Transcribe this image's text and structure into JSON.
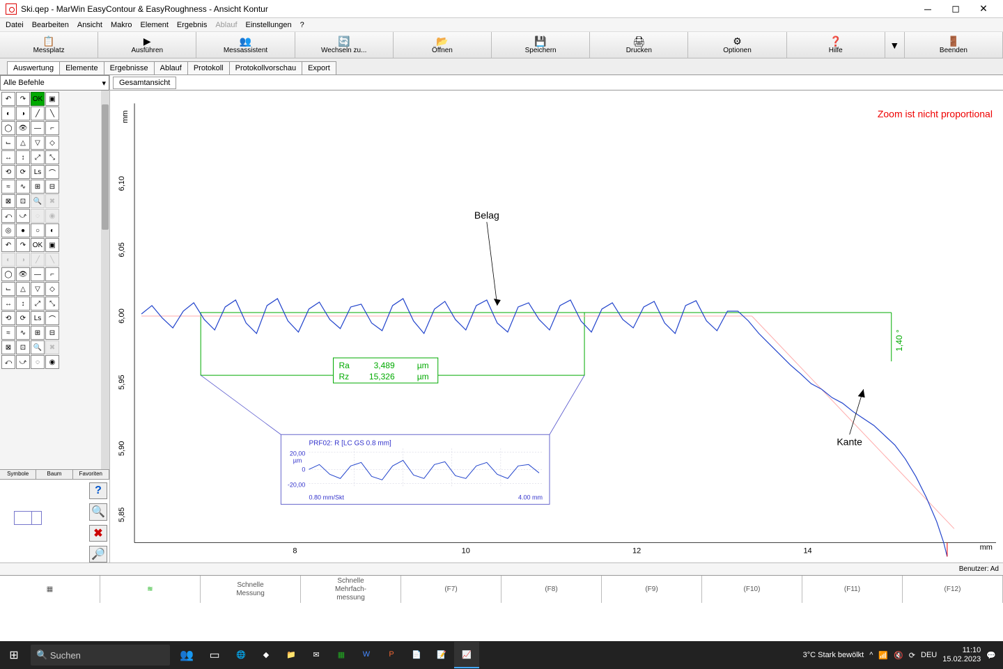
{
  "title": "Ski.qep - MarWin EasyContour & EasyRoughness - Ansicht Kontur",
  "menu": [
    "Datei",
    "Bearbeiten",
    "Ansicht",
    "Makro",
    "Element",
    "Ergebnis",
    "Ablauf",
    "Einstellungen",
    "?"
  ],
  "menu_disabled_index": 6,
  "toolbar": [
    {
      "icon": "📋",
      "label": "Messplatz"
    },
    {
      "icon": "▶",
      "label": "Ausführen"
    },
    {
      "icon": "👥",
      "label": "Messassistent"
    },
    {
      "icon": "🔄",
      "label": "Wechseln zu..."
    },
    {
      "icon": "📂",
      "label": "Öffnen"
    },
    {
      "icon": "💾",
      "label": "Speichern"
    },
    {
      "icon": "🖨",
      "label": "Drucken"
    },
    {
      "icon": "⚙",
      "label": "Optionen"
    },
    {
      "icon": "❓",
      "label": "Hilfe"
    },
    {
      "icon": "▼",
      "label": ""
    },
    {
      "icon": "🚪",
      "label": "Beenden"
    }
  ],
  "tabs": [
    "Auswertung",
    "Elemente",
    "Ergebnisse",
    "Ablauf",
    "Protokoll",
    "Protokollvorschau",
    "Export"
  ],
  "combo_label": "Alle Befehle",
  "chart_tab": "Gesamtansicht",
  "subtabs": [
    "Symbole",
    "Baum",
    "Favoriten"
  ],
  "chart": {
    "zoom_warning": "Zoom ist nicht proportional",
    "y_unit": "mm",
    "x_unit": "mm",
    "annotations": {
      "belag": "Belag",
      "kante": "Kante",
      "angle": "1,40 °"
    },
    "roughness_box": {
      "ra_label": "Ra",
      "ra_value": "3,489",
      "ra_unit": "µm",
      "rz_label": "Rz",
      "rz_value": "15,326",
      "rz_unit": "µm"
    },
    "inset": {
      "title": "PRF02: R [LC GS 0.8 mm]",
      "y_top": "20,00",
      "y_unit": "µm",
      "y_zero": "0",
      "y_bot": "-20,00",
      "x_left": "0.80 mm/Skt",
      "x_right": "4.00 mm"
    }
  },
  "chart_data": {
    "type": "line",
    "xlabel": "mm",
    "ylabel": "mm",
    "x_range": [
      6.5,
      15.5
    ],
    "y_range": [
      5.83,
      6.13
    ],
    "x_ticks": [
      8,
      10,
      12,
      14
    ],
    "y_ticks": [
      5.85,
      5.9,
      5.95,
      6.0,
      6.05,
      6.1
    ],
    "note": "Roughness contour profile of ski base (Belag) and edge (Kante). Profile oscillates around y≈6.00 from x≈6.5 to x≈13.5, then descends along edge to y≈5.82 at x≈15.3.",
    "roughness": {
      "Ra_um": 3.489,
      "Rz_um": 15.326
    },
    "edge_angle_deg": 1.4,
    "inset_profile": {
      "title": "PRF02: R [LC GS 0.8 mm]",
      "y_range_um": [
        -20,
        20
      ],
      "x_scale": "0.80 mm/Skt",
      "x_max_mm": 4.0
    }
  },
  "status": "Benutzer: Ad",
  "fkeys": [
    "",
    "",
    "Schnelle\nMessung",
    "Schnelle\nMehrfach-\nmessung",
    "(F7)",
    "(F8)",
    "(F9)",
    "(F10)",
    "(F11)",
    "(F12)"
  ],
  "taskbar": {
    "search_placeholder": "Suchen",
    "weather": "3°C  Stark bewölkt",
    "lang": "DEU",
    "time": "11:10",
    "date": "15.02.2023"
  }
}
